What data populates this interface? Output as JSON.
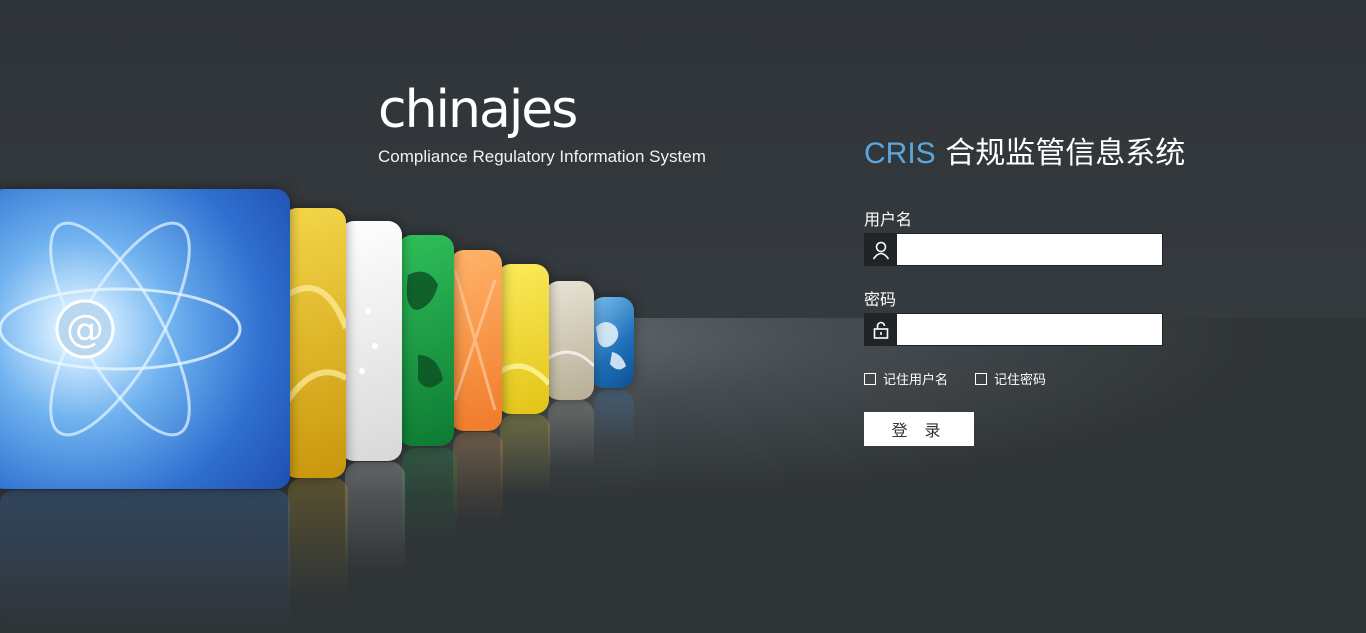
{
  "brand": {
    "logo_text": "chinajes",
    "tagline": "Compliance Regulatory Information System"
  },
  "login": {
    "title_prefix": "CRIS",
    "title_name": "合规监管信息系统",
    "username_label": "用户名",
    "username_value": "",
    "password_label": "密码",
    "password_value": "",
    "remember_username": "记住用户名",
    "remember_password": "记住密码",
    "login_button": "登 录"
  },
  "colors": {
    "accent": "#5aa6e0",
    "background": "#33383c"
  },
  "icons": {
    "username": "user-icon",
    "password": "lock-icon"
  }
}
